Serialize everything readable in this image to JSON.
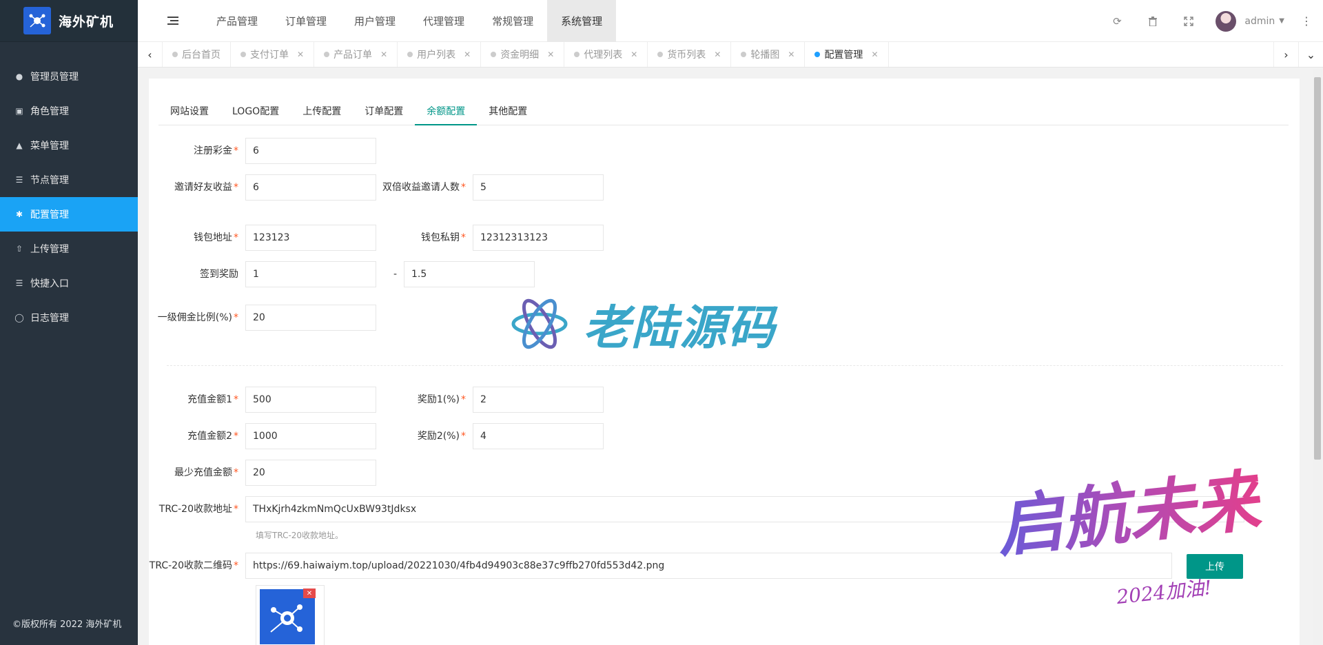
{
  "app": {
    "title": "海外矿机",
    "copyright": "©版权所有 2022 海外矿机"
  },
  "sidebar": {
    "items": [
      {
        "label": "管理员管理",
        "icon": "user-icon"
      },
      {
        "label": "角色管理",
        "icon": "role-icon"
      },
      {
        "label": "菜单管理",
        "icon": "tree-icon"
      },
      {
        "label": "节点管理",
        "icon": "list-icon"
      },
      {
        "label": "配置管理",
        "icon": "gear-icon",
        "active": true
      },
      {
        "label": "上传管理",
        "icon": "upload-icon"
      },
      {
        "label": "快捷入口",
        "icon": "list-icon"
      },
      {
        "label": "日志管理",
        "icon": "log-icon"
      }
    ]
  },
  "header": {
    "nav": [
      "产品管理",
      "订单管理",
      "用户管理",
      "代理管理",
      "常规管理",
      "系统管理"
    ],
    "active_nav": "系统管理",
    "user": "admin"
  },
  "tabs": [
    {
      "label": "后台首页",
      "closable": false
    },
    {
      "label": "支付订单",
      "closable": true
    },
    {
      "label": "产品订单",
      "closable": true
    },
    {
      "label": "用户列表",
      "closable": true
    },
    {
      "label": "资金明细",
      "closable": true
    },
    {
      "label": "代理列表",
      "closable": true
    },
    {
      "label": "货币列表",
      "closable": true
    },
    {
      "label": "轮播图",
      "closable": true
    },
    {
      "label": "配置管理",
      "closable": true,
      "active": true
    }
  ],
  "form_tabs": [
    "网站设置",
    "LOGO配置",
    "上传配置",
    "订单配置",
    "余额配置",
    "其他配置"
  ],
  "active_form_tab": "余额配置",
  "form": {
    "register_bonus": {
      "label": "注册彩金",
      "value": "6"
    },
    "invite_income": {
      "label": "邀请好友收益",
      "value": "6"
    },
    "double_invite_count": {
      "label": "双倍收益邀请人数",
      "value": "5"
    },
    "wallet_address": {
      "label": "钱包地址",
      "value": "123123"
    },
    "wallet_key": {
      "label": "钱包私钥",
      "value": "12312313123"
    },
    "checkin_reward": {
      "label": "签到奖励",
      "min": "1",
      "max": "1.5",
      "sep": "-"
    },
    "level1_commission": {
      "label": "一级佣金比例(%)",
      "value": "20"
    },
    "recharge1": {
      "label": "充值金额1",
      "value": "500"
    },
    "reward1": {
      "label": "奖励1(%)",
      "value": "2"
    },
    "recharge2": {
      "label": "充值金额2",
      "value": "1000"
    },
    "reward2": {
      "label": "奖励2(%)",
      "value": "4"
    },
    "min_recharge": {
      "label": "最少充值金额",
      "value": "20"
    },
    "trc20_address": {
      "label": "TRC-20收款地址",
      "value": "THxKjrh4zkmNmQcUxBW93tJdksx",
      "hint": "填写TRC-20收款地址。"
    },
    "trc20_qr": {
      "label": "TRC-20收款二维码",
      "value": "https://69.haiwaiym.top/upload/20221030/4fb4d94903c88e37c9ffb270fd553d42.png",
      "upload_label": "上传"
    }
  },
  "watermarks": {
    "center": "老陆源码",
    "corner": "启航未来",
    "corner_sub": "2024加油!"
  }
}
